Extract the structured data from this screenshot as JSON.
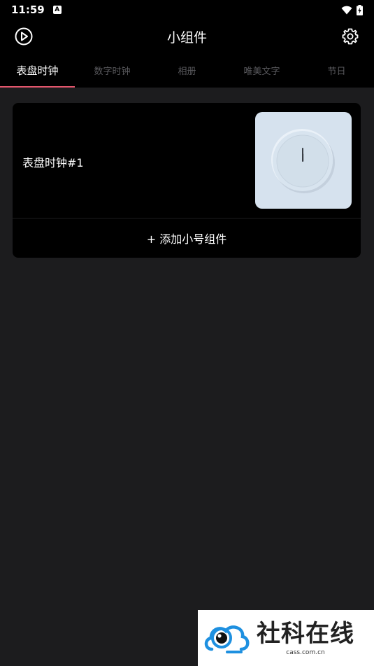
{
  "status_bar": {
    "time": "11:59",
    "notification_icon_letter": "A",
    "icons": [
      "wifi-icon",
      "battery-charging-icon"
    ]
  },
  "app_bar": {
    "title": "小组件",
    "left_icon": "play-circle-icon",
    "right_icon": "gear-icon"
  },
  "tabs": [
    {
      "label": "表盘时钟",
      "active": true
    },
    {
      "label": "数字时钟",
      "active": false
    },
    {
      "label": "相册",
      "active": false
    },
    {
      "label": "唯美文字",
      "active": false
    },
    {
      "label": "节日",
      "active": false
    }
  ],
  "widget_card": {
    "name": "表盘时钟#1",
    "preview_icon": "analog-clock-icon",
    "add_button_label": "+ 添加小号组件"
  },
  "watermark": {
    "title": "社科在线",
    "url": "cass.com.cn"
  },
  "colors": {
    "background": "#1c1c1e",
    "bar_background": "#000000",
    "tab_indicator": "#e2566c",
    "tab_inactive_text": "#5a5a5e",
    "clock_preview_bg": "#d6e2ee",
    "watermark_blue": "#1e90e0"
  }
}
